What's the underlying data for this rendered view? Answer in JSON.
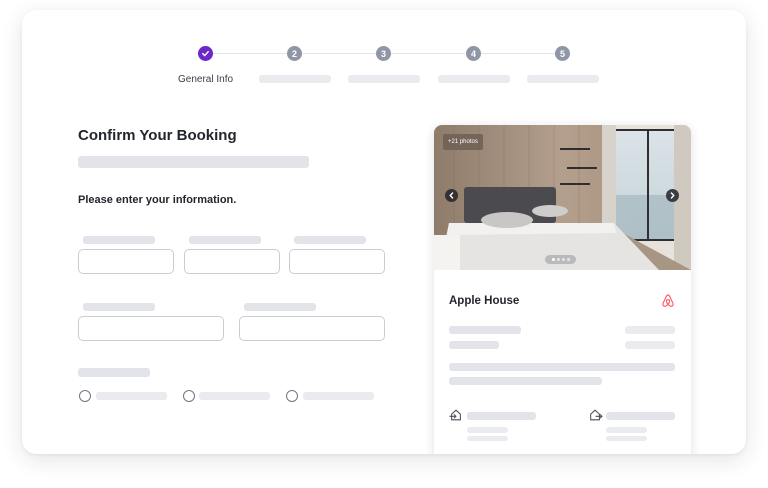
{
  "stepper": {
    "steps": [
      {
        "number": "",
        "label": "General Info",
        "state": "completed"
      },
      {
        "number": "2",
        "label": "",
        "state": "pending"
      },
      {
        "number": "3",
        "label": "",
        "state": "pending"
      },
      {
        "number": "4",
        "label": "",
        "state": "pending"
      },
      {
        "number": "5",
        "label": "",
        "state": "pending"
      }
    ],
    "active_color": "#6d28c9",
    "pending_color": "#8f97a6",
    "check_icon": "check-icon"
  },
  "form": {
    "title": "Confirm Your Booking",
    "subtitle": "Please enter your information."
  },
  "listing": {
    "photo_badge": "+21 photos",
    "name": "Apple House",
    "brand_icon": "airbnb-icon",
    "brand_color": "#ff5a5f",
    "checkin_icon": "home-enter-icon",
    "checkout_icon": "home-exit-icon"
  }
}
